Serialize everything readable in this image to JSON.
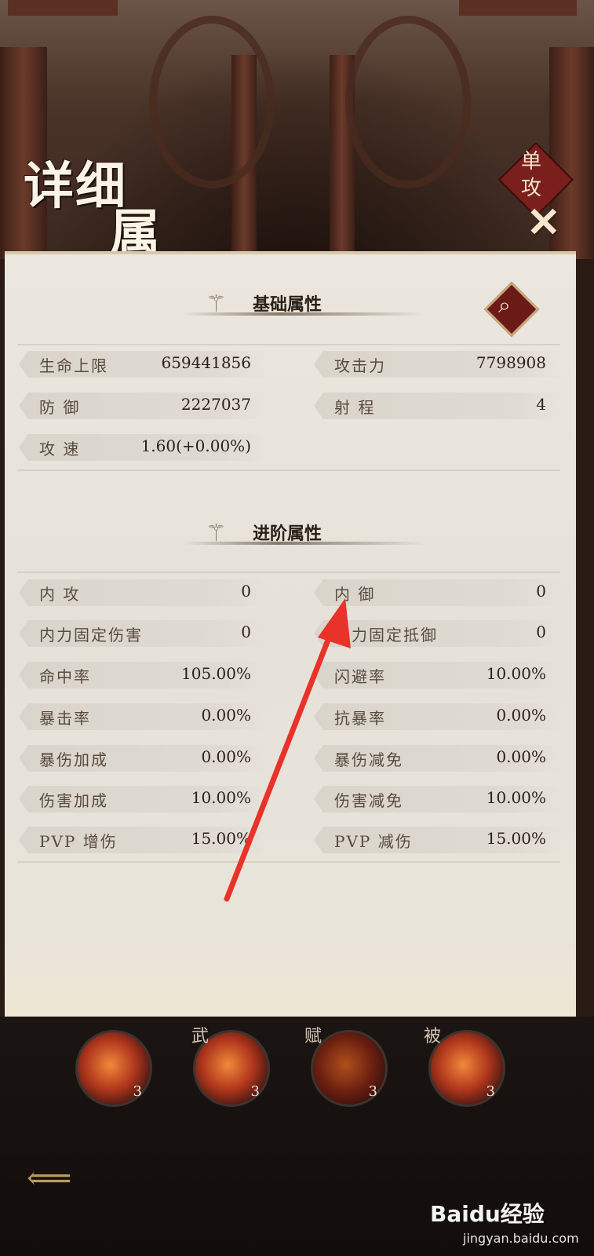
{
  "header": {
    "title_line1": "详细",
    "title_line2": "属性",
    "badge_text": "单攻",
    "close_glyph": "✕"
  },
  "basic": {
    "heading": "基础属性",
    "stats": [
      {
        "label": "生命上限",
        "value": "659441856"
      },
      {
        "label": "攻击力",
        "value": "7798908"
      },
      {
        "label": "防 御",
        "value": "2227037"
      },
      {
        "label": "射 程",
        "value": "4"
      },
      {
        "label": "攻 速",
        "value": "1.60(+0.00%)"
      }
    ]
  },
  "advanced": {
    "heading": "进阶属性",
    "stats": [
      {
        "label": "内 攻",
        "value": "0"
      },
      {
        "label": "内 御",
        "value": "0"
      },
      {
        "label": "内力固定伤害",
        "value": "0"
      },
      {
        "label": "内力固定抵御",
        "value": "0"
      },
      {
        "label": "命中率",
        "value": "105.00%"
      },
      {
        "label": "闪避率",
        "value": "10.00%"
      },
      {
        "label": "暴击率",
        "value": "0.00%"
      },
      {
        "label": "抗暴率",
        "value": "0.00%"
      },
      {
        "label": "暴伤加成",
        "value": "0.00%"
      },
      {
        "label": "暴伤减免",
        "value": "0.00%"
      },
      {
        "label": "伤害加成",
        "value": "10.00%"
      },
      {
        "label": "伤害减免",
        "value": "10.00%"
      },
      {
        "label": "PVP 增伤",
        "value": "15.00%"
      },
      {
        "label": "PVP 减伤",
        "value": "15.00%"
      }
    ]
  },
  "skills": [
    {
      "tag": "",
      "level": "3"
    },
    {
      "tag": "武",
      "level": "3"
    },
    {
      "tag": "赋",
      "level": "3"
    },
    {
      "tag": "被",
      "level": "3"
    }
  ],
  "watermark": {
    "brand": "Baidu经验",
    "url": "jingyan.baidu.com"
  },
  "annotation_color": "#e8322a",
  "icons": {
    "search": "search-icon",
    "close": "close-icon",
    "back": "back-arrow-icon"
  }
}
